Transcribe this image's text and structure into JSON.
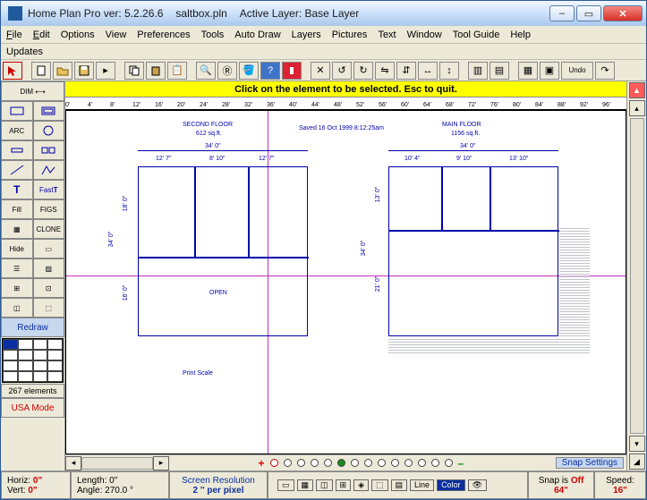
{
  "title": {
    "app": "Home Plan Pro ver: 5.2.26.6",
    "file": "saltbox.pln",
    "layer_label": "Active Layer: Base Layer"
  },
  "menu": {
    "file": "File",
    "edit": "Edit",
    "options": "Options",
    "view": "View",
    "preferences": "Preferences",
    "tools": "Tools",
    "autodraw": "Auto Draw",
    "layers": "Layers",
    "pictures": "Pictures",
    "text": "Text",
    "window": "Window",
    "toolguide": "Tool Guide",
    "help": "Help",
    "updates": "Updates"
  },
  "hint": "Click on the element to be selected.  Esc to quit.",
  "ruler_ticks": [
    "0'",
    "4'",
    "8'",
    "12'",
    "16'",
    "20'",
    "24'",
    "28'",
    "32'",
    "36'",
    "40'",
    "44'",
    "48'",
    "52'",
    "56'",
    "60'",
    "64'",
    "68'",
    "72'",
    "76'",
    "80'",
    "84'",
    "88'",
    "92'",
    "96'"
  ],
  "left": {
    "dim": "DIM",
    "arc": "ARC",
    "t": "T",
    "fast": "Fast",
    "fill": "Fill",
    "figs": "FIGS",
    "clone": "CLONE",
    "hide": "Hide",
    "redraw": "Redraw",
    "count": "267 elements",
    "usa": "USA Mode"
  },
  "plan": {
    "saved": "Saved 16 Oct 1999  8:12:25am",
    "second": {
      "title": "SECOND FLOOR",
      "area": "612 sq.ft.",
      "w": "34'  0\"",
      "h": "34'  0\"",
      "d1": "12'  7\"",
      "d2": "8'  10\"",
      "d3": "12'  7\"",
      "v1": "18'  0\"",
      "v2": "16'  0\"",
      "open": "OPEN",
      "print": "Print Scale"
    },
    "main": {
      "title": "MAIN FLOOR",
      "area": "1156 sq.ft.",
      "w": "34'  0\"",
      "h": "34'  0\"",
      "d1": "10'  4\"",
      "d2": "9'  10\"",
      "d3": "13'  10\"",
      "v1": "13'  0\"",
      "v2": "21'  0\""
    }
  },
  "snap_settings": "Snap Settings",
  "status": {
    "horiz_l": "Horiz:",
    "horiz_v": "0\"",
    "vert_l": "Vert:",
    "vert_v": "0\"",
    "len_l": "Length:",
    "len_v": "0\"",
    "ang_l": "Angle:",
    "ang_v": "270.0 °",
    "sr1": "Screen Resolution",
    "sr2": "2 '' per pixel",
    "line": "Line",
    "color": "Color",
    "snap_l": "Snap is",
    "snap_v": "Off",
    "snap_n": "64\"",
    "speed_l": "Speed:",
    "speed_v": "16\""
  },
  "undo": "Undo"
}
